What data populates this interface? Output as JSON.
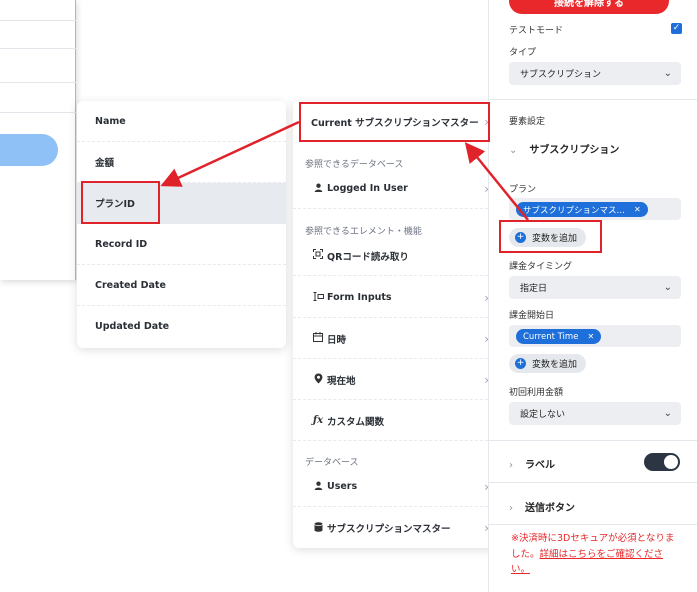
{
  "fields": [
    "Name",
    "金額",
    "プランID",
    "Record ID",
    "Created Date",
    "Updated Date"
  ],
  "selected_field": "プランID",
  "sources": {
    "current": "Current サブスクリプションマスター",
    "section_db_ref": "参照できるデータベース",
    "logged_in_user": "Logged In User",
    "section_elements": "参照できるエレメント・機能",
    "qr": "QRコード読み取り",
    "form_inputs": "Form Inputs",
    "datetime": "日時",
    "location": "現在地",
    "custom_func": "カスタム関数",
    "section_database": "データベース",
    "users": "Users",
    "subscription_master": "サブスクリプションマスター",
    "icons": {
      "qr": "qr-scan-icon",
      "form_inputs": "form-input-icon",
      "datetime": "calendar-icon",
      "location": "location-pin-icon",
      "custom_func": "function-icon",
      "user": "user-icon",
      "database": "database-icon"
    }
  },
  "settings": {
    "disconnect_label": "接続を解除する",
    "test_mode_label": "テストモード",
    "test_mode_checked": true,
    "type_label": "タイプ",
    "type_value": "サブスクリプション",
    "elements_label": "要素設定",
    "subscription_section": "サブスクリプション",
    "plan_label": "プラン",
    "plan_chip": "サブスクリプションマス…",
    "add_variable": "変数を追加",
    "billing_timing_label": "課金タイミング",
    "billing_timing_value": "指定日",
    "billing_start_label": "課金開始日",
    "billing_start_chip": "Current Time",
    "initial_amount_label": "初回利用金額",
    "initial_amount_value": "設定しない",
    "label_section": "ラベル",
    "label_toggle_on": true,
    "submit_section": "送信ボタン",
    "notice_text": "※決済時に3Dセキュアが必須となりました。",
    "notice_link": "詳細はこちらをご確認ください。"
  },
  "colors": {
    "accent_blue": "#1e6fd9",
    "danger_red": "#e8282b",
    "annotation_red": "#e0232a"
  }
}
